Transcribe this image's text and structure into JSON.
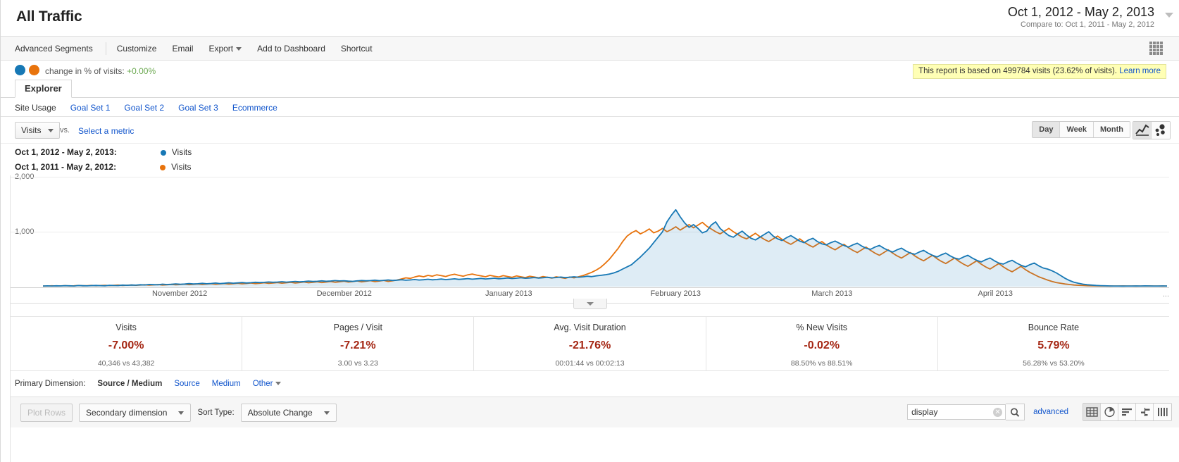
{
  "header": {
    "title": "All Traffic",
    "date_range": "Oct 1, 2012 - May 2, 2013",
    "compare_to": "Compare to: Oct 1, 2011 - May 2, 2012"
  },
  "actionbar": {
    "items": [
      "Advanced Segments",
      "Customize",
      "Email",
      "Export",
      "Add to Dashboard",
      "Shortcut"
    ]
  },
  "compare": {
    "text": "change in % of visits:",
    "value": "+0.00%",
    "notice": "This report is based on 499784 visits (23.62% of visits).",
    "notice_link": "Learn more"
  },
  "tabs": {
    "explorer": "Explorer",
    "subtabs": [
      "Site Usage",
      "Goal Set 1",
      "Goal Set 2",
      "Goal Set 3",
      "Ecommerce"
    ]
  },
  "metric_controls": {
    "metric": "Visits",
    "vs": "vs.",
    "select_metric": "Select a metric",
    "granularity": [
      "Day",
      "Week",
      "Month"
    ],
    "granularity_active": "Day"
  },
  "legend": {
    "line1_range": "Oct 1, 2012 - May 2, 2013:",
    "line1_metric": "Visits",
    "line2_range": "Oct 1, 2011 - May 2, 2012:",
    "line2_metric": "Visits",
    "color_current": "#1778b5",
    "color_previous": "#e8730c"
  },
  "chart_data": {
    "type": "line",
    "title": "Visits",
    "xlabel": "",
    "ylabel": "Visits",
    "ylim": [
      0,
      2000
    ],
    "ytick_labels": [
      "1,000",
      "2,000"
    ],
    "yticks": [
      1000,
      2000
    ],
    "grid": true,
    "legend_position": "above",
    "xtick_labels": [
      "November 2012",
      "December 2012",
      "January 2013",
      "February 2013",
      "March 2013",
      "April 2013"
    ],
    "xtick_positions_pct": [
      14.6,
      28.8,
      43.0,
      57.4,
      70.9,
      85.0
    ],
    "series": [
      {
        "name": "Visits",
        "range": "Oct 1, 2012 - May 2, 2013",
        "color": "#1778b5",
        "filled": true,
        "values": [
          12,
          14,
          11,
          16,
          13,
          18,
          15,
          12,
          20,
          17,
          14,
          19,
          22,
          18,
          16,
          25,
          21,
          19,
          28,
          24,
          30,
          27,
          35,
          31,
          40,
          36,
          33,
          45,
          38,
          42,
          50,
          44,
          48,
          55,
          49,
          53,
          60,
          52,
          58,
          65,
          57,
          62,
          70,
          63,
          68,
          75,
          67,
          72,
          80,
          74,
          78,
          85,
          79,
          83,
          90,
          82,
          88,
          95,
          87,
          92,
          100,
          93,
          98,
          105,
          97,
          102,
          110,
          104,
          108,
          100,
          96,
          105,
          112,
          106,
          110,
          118,
          109,
          114,
          122,
          113,
          118,
          126,
          117,
          122,
          130,
          120,
          126,
          134,
          124,
          130,
          138,
          128,
          134,
          142,
          132,
          138,
          146,
          136,
          142,
          150,
          140,
          146,
          154,
          144,
          150,
          158,
          148,
          154,
          162,
          152,
          158,
          166,
          156,
          162,
          170,
          160,
          166,
          174,
          164,
          170,
          180,
          172,
          178,
          190,
          182,
          196,
          205,
          215,
          230,
          250,
          280,
          320,
          360,
          400,
          470,
          540,
          620,
          700,
          800,
          900,
          1000,
          1180,
          1300,
          1400,
          1270,
          1160,
          1080,
          1130,
          1060,
          980,
          1010,
          1120,
          1180,
          1060,
          990,
          930,
          900,
          960,
          1010,
          940,
          880,
          850,
          900,
          950,
          1000,
          920,
          870,
          840,
          890,
          930,
          880,
          830,
          800,
          850,
          880,
          820,
          780,
          760,
          800,
          830,
          790,
          750,
          720,
          760,
          790,
          740,
          700,
          680,
          720,
          750,
          700,
          660,
          630,
          670,
          700,
          650,
          610,
          590,
          630,
          660,
          610,
          570,
          540,
          580,
          610,
          560,
          520,
          500,
          540,
          570,
          520,
          480,
          450,
          490,
          520,
          470,
          430,
          410,
          450,
          480,
          430,
          390,
          360,
          400,
          430,
          380,
          340,
          320,
          290,
          250,
          200,
          150,
          110,
          80,
          60,
          45,
          35,
          28,
          22,
          18,
          15,
          13,
          12,
          11,
          10,
          12,
          11,
          13,
          12,
          14,
          13,
          12,
          11,
          13,
          12
        ]
      },
      {
        "name": "Visits",
        "range": "Oct 1, 2011 - May 2, 2012",
        "color": "#e8730c",
        "filled": false,
        "values": [
          10,
          12,
          15,
          11,
          14,
          18,
          13,
          16,
          20,
          15,
          18,
          22,
          17,
          20,
          25,
          19,
          23,
          28,
          21,
          26,
          30,
          24,
          29,
          34,
          27,
          32,
          38,
          30,
          35,
          41,
          33,
          39,
          45,
          36,
          42,
          49,
          40,
          46,
          53,
          44,
          50,
          57,
          47,
          54,
          62,
          51,
          58,
          66,
          55,
          62,
          70,
          59,
          66,
          75,
          63,
          70,
          79,
          67,
          74,
          84,
          71,
          79,
          89,
          75,
          83,
          94,
          79,
          88,
          99,
          83,
          92,
          104,
          87,
          97,
          109,
          91,
          101,
          114,
          95,
          106,
          120,
          140,
          160,
          150,
          175,
          195,
          180,
          205,
          190,
          215,
          200,
          185,
          210,
          225,
          205,
          190,
          215,
          230,
          210,
          195,
          180,
          205,
          190,
          175,
          200,
          185,
          170,
          195,
          180,
          165,
          190,
          175,
          160,
          185,
          170,
          155,
          180,
          165,
          150,
          175,
          160,
          180,
          200,
          230,
          260,
          300,
          350,
          420,
          500,
          600,
          700,
          820,
          920,
          980,
          1020,
          960,
          1000,
          1050,
          980,
          1010,
          1060,
          1000,
          1040,
          1090,
          1030,
          1080,
          1130,
          1070,
          1120,
          1170,
          1100,
          1050,
          1000,
          960,
          1010,
          1060,
          1000,
          950,
          900,
          870,
          920,
          970,
          910,
          860,
          820,
          870,
          920,
          860,
          810,
          770,
          820,
          870,
          810,
          760,
          720,
          770,
          820,
          760,
          710,
          670,
          720,
          770,
          710,
          660,
          620,
          670,
          720,
          660,
          610,
          570,
          620,
          670,
          610,
          560,
          520,
          570,
          620,
          560,
          510,
          470,
          520,
          570,
          510,
          460,
          420,
          470,
          520,
          460,
          410,
          370,
          420,
          470,
          410,
          360,
          320,
          370,
          420,
          360,
          310,
          270,
          320,
          370,
          310,
          260,
          220,
          180,
          150,
          120,
          95,
          75,
          60,
          48,
          38,
          30,
          24,
          20,
          17,
          15,
          13,
          12,
          11,
          10,
          12,
          11,
          13,
          12,
          11,
          10,
          12,
          11,
          13,
          12,
          11,
          10,
          12
        ]
      }
    ]
  },
  "summary": {
    "cells": [
      {
        "title": "Visits",
        "value": "-7.00%",
        "sub": "40,346 vs 43,382",
        "color": "#a52714"
      },
      {
        "title": "Pages / Visit",
        "value": "-7.21%",
        "sub": "3.00 vs 3.23",
        "color": "#a52714"
      },
      {
        "title": "Avg. Visit Duration",
        "value": "-21.76%",
        "sub": "00:01:44 vs 00:02:13",
        "color": "#a52714"
      },
      {
        "title": "% New Visits",
        "value": "-0.02%",
        "sub": "88.50% vs 88.51%",
        "color": "#a52714"
      },
      {
        "title": "Bounce Rate",
        "value": "5.79%",
        "sub": "56.28% vs 53.20%",
        "color": "#a52714"
      }
    ]
  },
  "primary_dimension": {
    "label": "Primary Dimension:",
    "active": "Source / Medium",
    "links": [
      "Source",
      "Medium"
    ],
    "other": "Other"
  },
  "bottom_toolbar": {
    "plot_rows": "Plot Rows",
    "secondary_dimension": "Secondary dimension",
    "sort_type_label": "Sort Type:",
    "sort_type_value": "Absolute Change",
    "search_value": "display",
    "search_placeholder": "",
    "advanced": "advanced"
  }
}
